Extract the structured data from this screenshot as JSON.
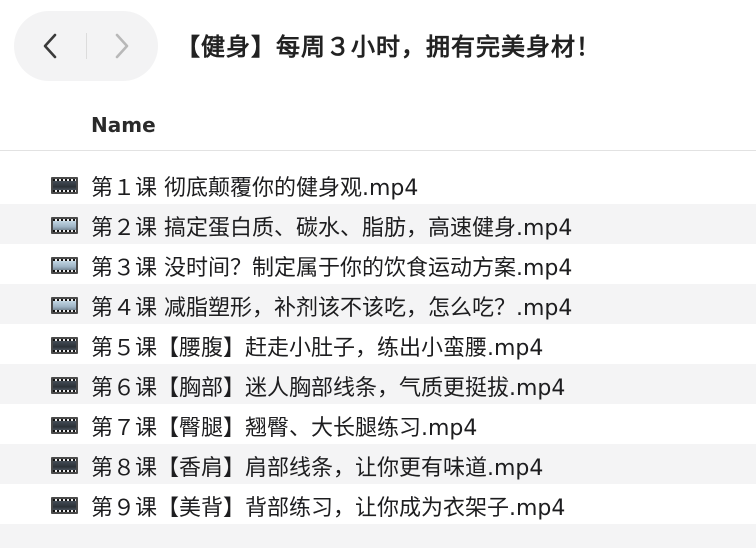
{
  "window": {
    "title": "【健身】每周３小时，拥有完美身材！"
  },
  "toolbar": {
    "back_icon": "chevron-left-icon",
    "forward_icon": "chevron-right-icon"
  },
  "columns": {
    "name": "Name"
  },
  "files": [
    {
      "name": "第１课 彻底颠覆你的健身观.mp4",
      "icon": "video-file-icon"
    },
    {
      "name": "第２课 搞定蛋白质、碳水、脂肪，高速健身.mp4",
      "icon": "video-file-icon"
    },
    {
      "name": "第３课 没时间？制定属于你的饮食运动方案.mp4",
      "icon": "video-file-icon"
    },
    {
      "name": "第４课 减脂塑形，补剂该不该吃，怎么吃？.mp4",
      "icon": "video-file-icon"
    },
    {
      "name": "第５课【腰腹】赶走小肚子，练出小蛮腰.mp4",
      "icon": "video-file-icon"
    },
    {
      "name": "第６课【胸部】迷人胸部线条，气质更挺拔.mp4",
      "icon": "video-file-icon"
    },
    {
      "name": "第７课【臀腿】翘臀、大长腿练习.mp4",
      "icon": "video-file-icon"
    },
    {
      "name": "第８课【香肩】肩部线条，让你更有味道.mp4",
      "icon": "video-file-icon"
    },
    {
      "name": "第９课【美背】背部练习，让你成为衣架子.mp4",
      "icon": "video-file-icon"
    }
  ],
  "colors": {
    "stripe": "#f4f4f5",
    "nav_bg": "#f3f3f4",
    "text": "#1d1d1f"
  }
}
